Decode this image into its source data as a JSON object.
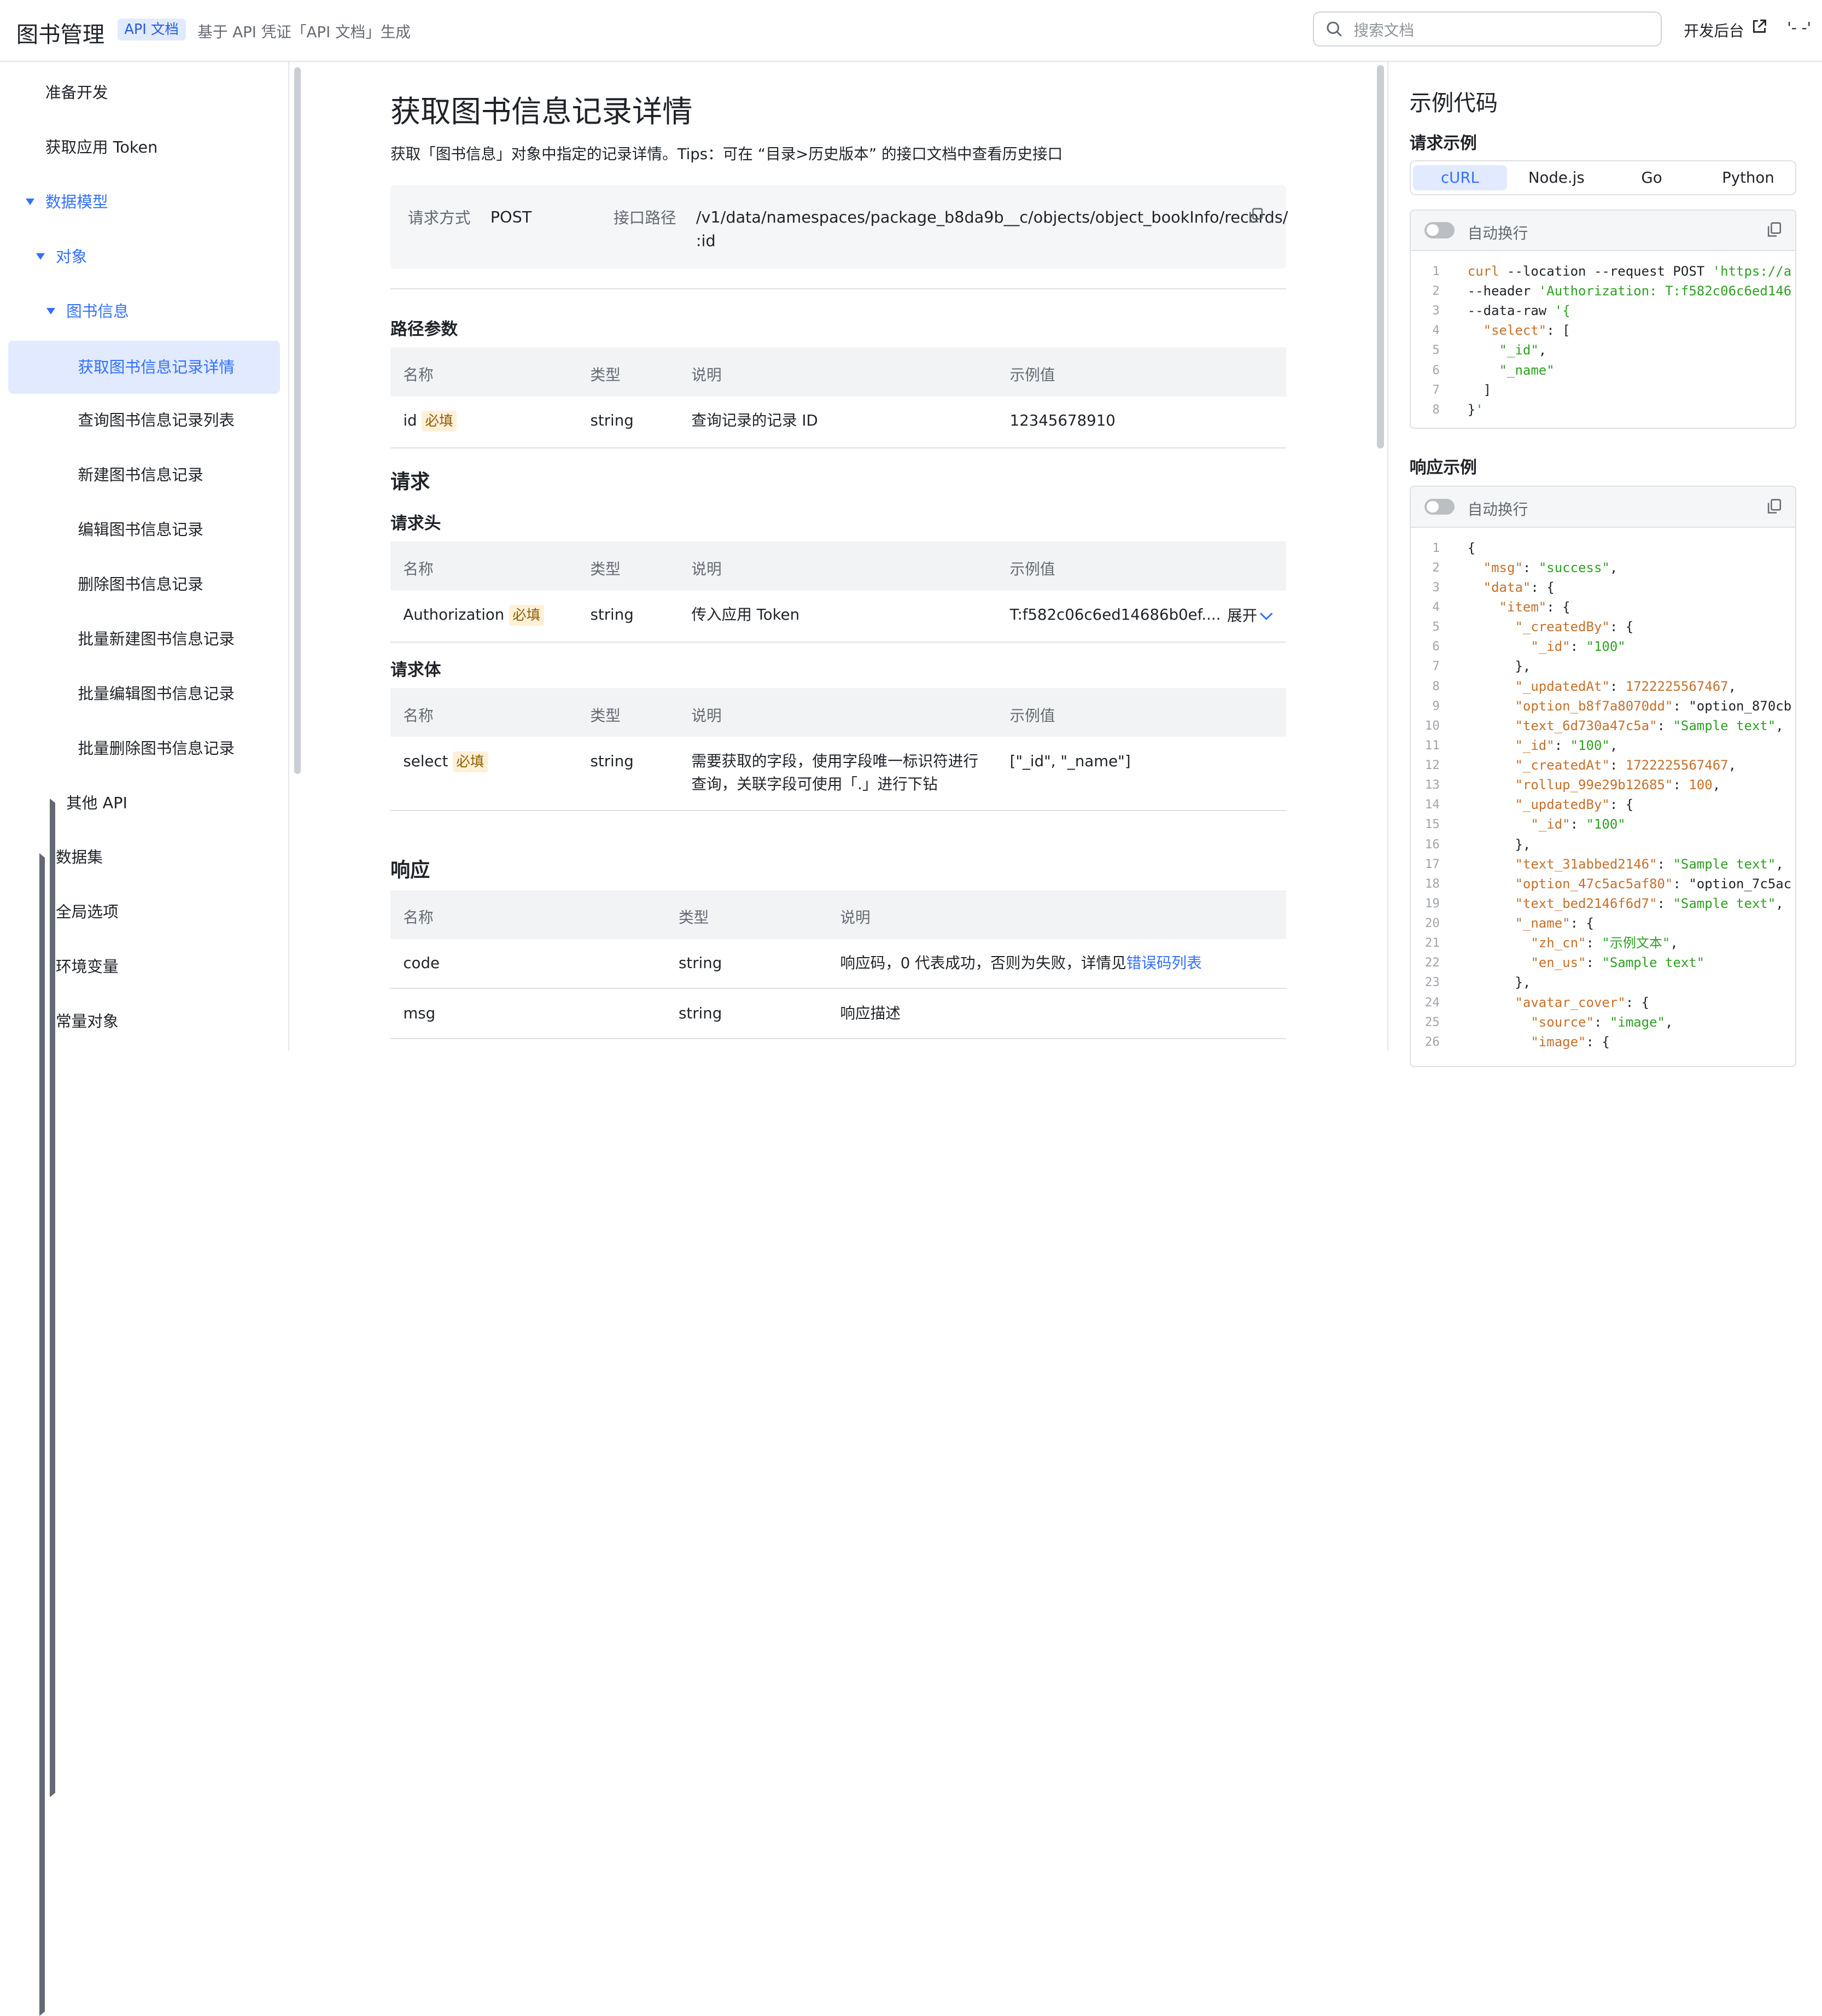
{
  "header": {
    "app_title": "图书管理",
    "badge": "API 文档",
    "subtitle": "基于 API 凭证「API 文档」生成",
    "search_placeholder": "搜索文档",
    "dev_console": "开发后台",
    "user_menu": "'- -'"
  },
  "sidebar": {
    "items": [
      {
        "label": "准备开发"
      },
      {
        "label": "获取应用 Token"
      },
      {
        "label": "数据模型"
      },
      {
        "label": "对象"
      },
      {
        "label": "图书信息"
      },
      {
        "label": "获取图书信息记录详情"
      },
      {
        "label": "查询图书信息记录列表"
      },
      {
        "label": "新建图书信息记录"
      },
      {
        "label": "编辑图书信息记录"
      },
      {
        "label": "删除图书信息记录"
      },
      {
        "label": "批量新建图书信息记录"
      },
      {
        "label": "批量编辑图书信息记录"
      },
      {
        "label": "批量删除图书信息记录"
      },
      {
        "label": "其他 API"
      },
      {
        "label": "数据集"
      },
      {
        "label": "全局选项"
      },
      {
        "label": "环境变量"
      },
      {
        "label": "常量对象"
      }
    ]
  },
  "main": {
    "title": "获取图书信息记录详情",
    "description": "获取「图书信息」对象中指定的记录详情。Tips：可在 “目录>历史版本” 的接口文档中查看历史接口",
    "method_label": "请求方式",
    "method": "POST",
    "path_label": "接口路径",
    "path_line1": "/v1/data/namespaces/package_b8da9b__c/objects/object_bookInfo/records/",
    "path_line2": ":id",
    "path_params_title": "路径参数",
    "request_title": "请求",
    "request_header_title": "请求头",
    "request_body_title": "请求体",
    "response_title": "响应",
    "col_name": "名称",
    "col_type": "类型",
    "col_desc": "说明",
    "col_example": "示例值",
    "required": "必填",
    "expand": "展开",
    "path_params": [
      {
        "name": "id",
        "type": "string",
        "desc": "查询记录的记录 ID",
        "example": "12345678910"
      }
    ],
    "headers": [
      {
        "name": "Authorization",
        "type": "string",
        "desc": "传入应用 Token",
        "example": "T:f582c06c6ed14686b0ef...."
      }
    ],
    "body": [
      {
        "name": "select",
        "type": "string",
        "desc_line1": "需要获取的字段，使用字段唯一标识符进行",
        "desc_line2": "查询，关联字段可使用「.」进行下钻",
        "example": "[\"_id\", \"_name\"]"
      }
    ],
    "response": [
      {
        "name": "code",
        "type": "string",
        "desc": "响应码，0 代表成功，否则为失败，详情见",
        "link": "错误码列表"
      },
      {
        "name": "msg",
        "type": "string",
        "desc": "响应描述"
      }
    ]
  },
  "right_panel": {
    "title": "示例代码",
    "request_example": "请求示例",
    "response_example": "响应示例",
    "tabs": [
      "cURL",
      "Node.js",
      "Go",
      "Python"
    ],
    "selected_tab": "cURL",
    "auto_wrap": "自动换行",
    "request_code": [
      [
        "1",
        "curl --location --request POST 'https://a"
      ],
      [
        "2",
        "--header 'Authorization: T:f582c06c6ed146"
      ],
      [
        "3",
        "--data-raw '{"
      ],
      [
        "4",
        "  \"select\": ["
      ],
      [
        "5",
        "    \"_id\","
      ],
      [
        "6",
        "    \"_name\""
      ],
      [
        "7",
        "  ]"
      ],
      [
        "8",
        "}'"
      ]
    ],
    "response_code": [
      [
        "1",
        "{"
      ],
      [
        "2",
        "  \"msg\": \"success\","
      ],
      [
        "3",
        "  \"data\": {"
      ],
      [
        "4",
        "    \"item\": {"
      ],
      [
        "5",
        "      \"_createdBy\": {"
      ],
      [
        "6",
        "        \"_id\": \"100\""
      ],
      [
        "7",
        "      },"
      ],
      [
        "8",
        "      \"_updatedAt\": 1722225567467,"
      ],
      [
        "9",
        "      \"option_b8f7a8070dd\": \"option_870cb"
      ],
      [
        "10",
        "      \"text_6d730a47c5a\": \"Sample text\","
      ],
      [
        "11",
        "      \"_id\": \"100\","
      ],
      [
        "12",
        "      \"_createdAt\": 1722225567467,"
      ],
      [
        "13",
        "      \"rollup_99e29b12685\": 100,"
      ],
      [
        "14",
        "      \"_updatedBy\": {"
      ],
      [
        "15",
        "        \"_id\": \"100\""
      ],
      [
        "16",
        "      },"
      ],
      [
        "17",
        "      \"text_31abbed2146\": \"Sample text\","
      ],
      [
        "18",
        "      \"option_47c5ac5af80\": \"option_7c5ac"
      ],
      [
        "19",
        "      \"text_bed2146f6d7\": \"Sample text\","
      ],
      [
        "20",
        "      \"_name\": {"
      ],
      [
        "21",
        "        \"zh_cn\": \"示例文本\","
      ],
      [
        "22",
        "        \"en_us\": \"Sample text\""
      ],
      [
        "23",
        "      },"
      ],
      [
        "24",
        "      \"avatar_cover\": {"
      ],
      [
        "25",
        "        \"source\": \"image\","
      ],
      [
        "26",
        "        \"image\": {"
      ]
    ]
  }
}
